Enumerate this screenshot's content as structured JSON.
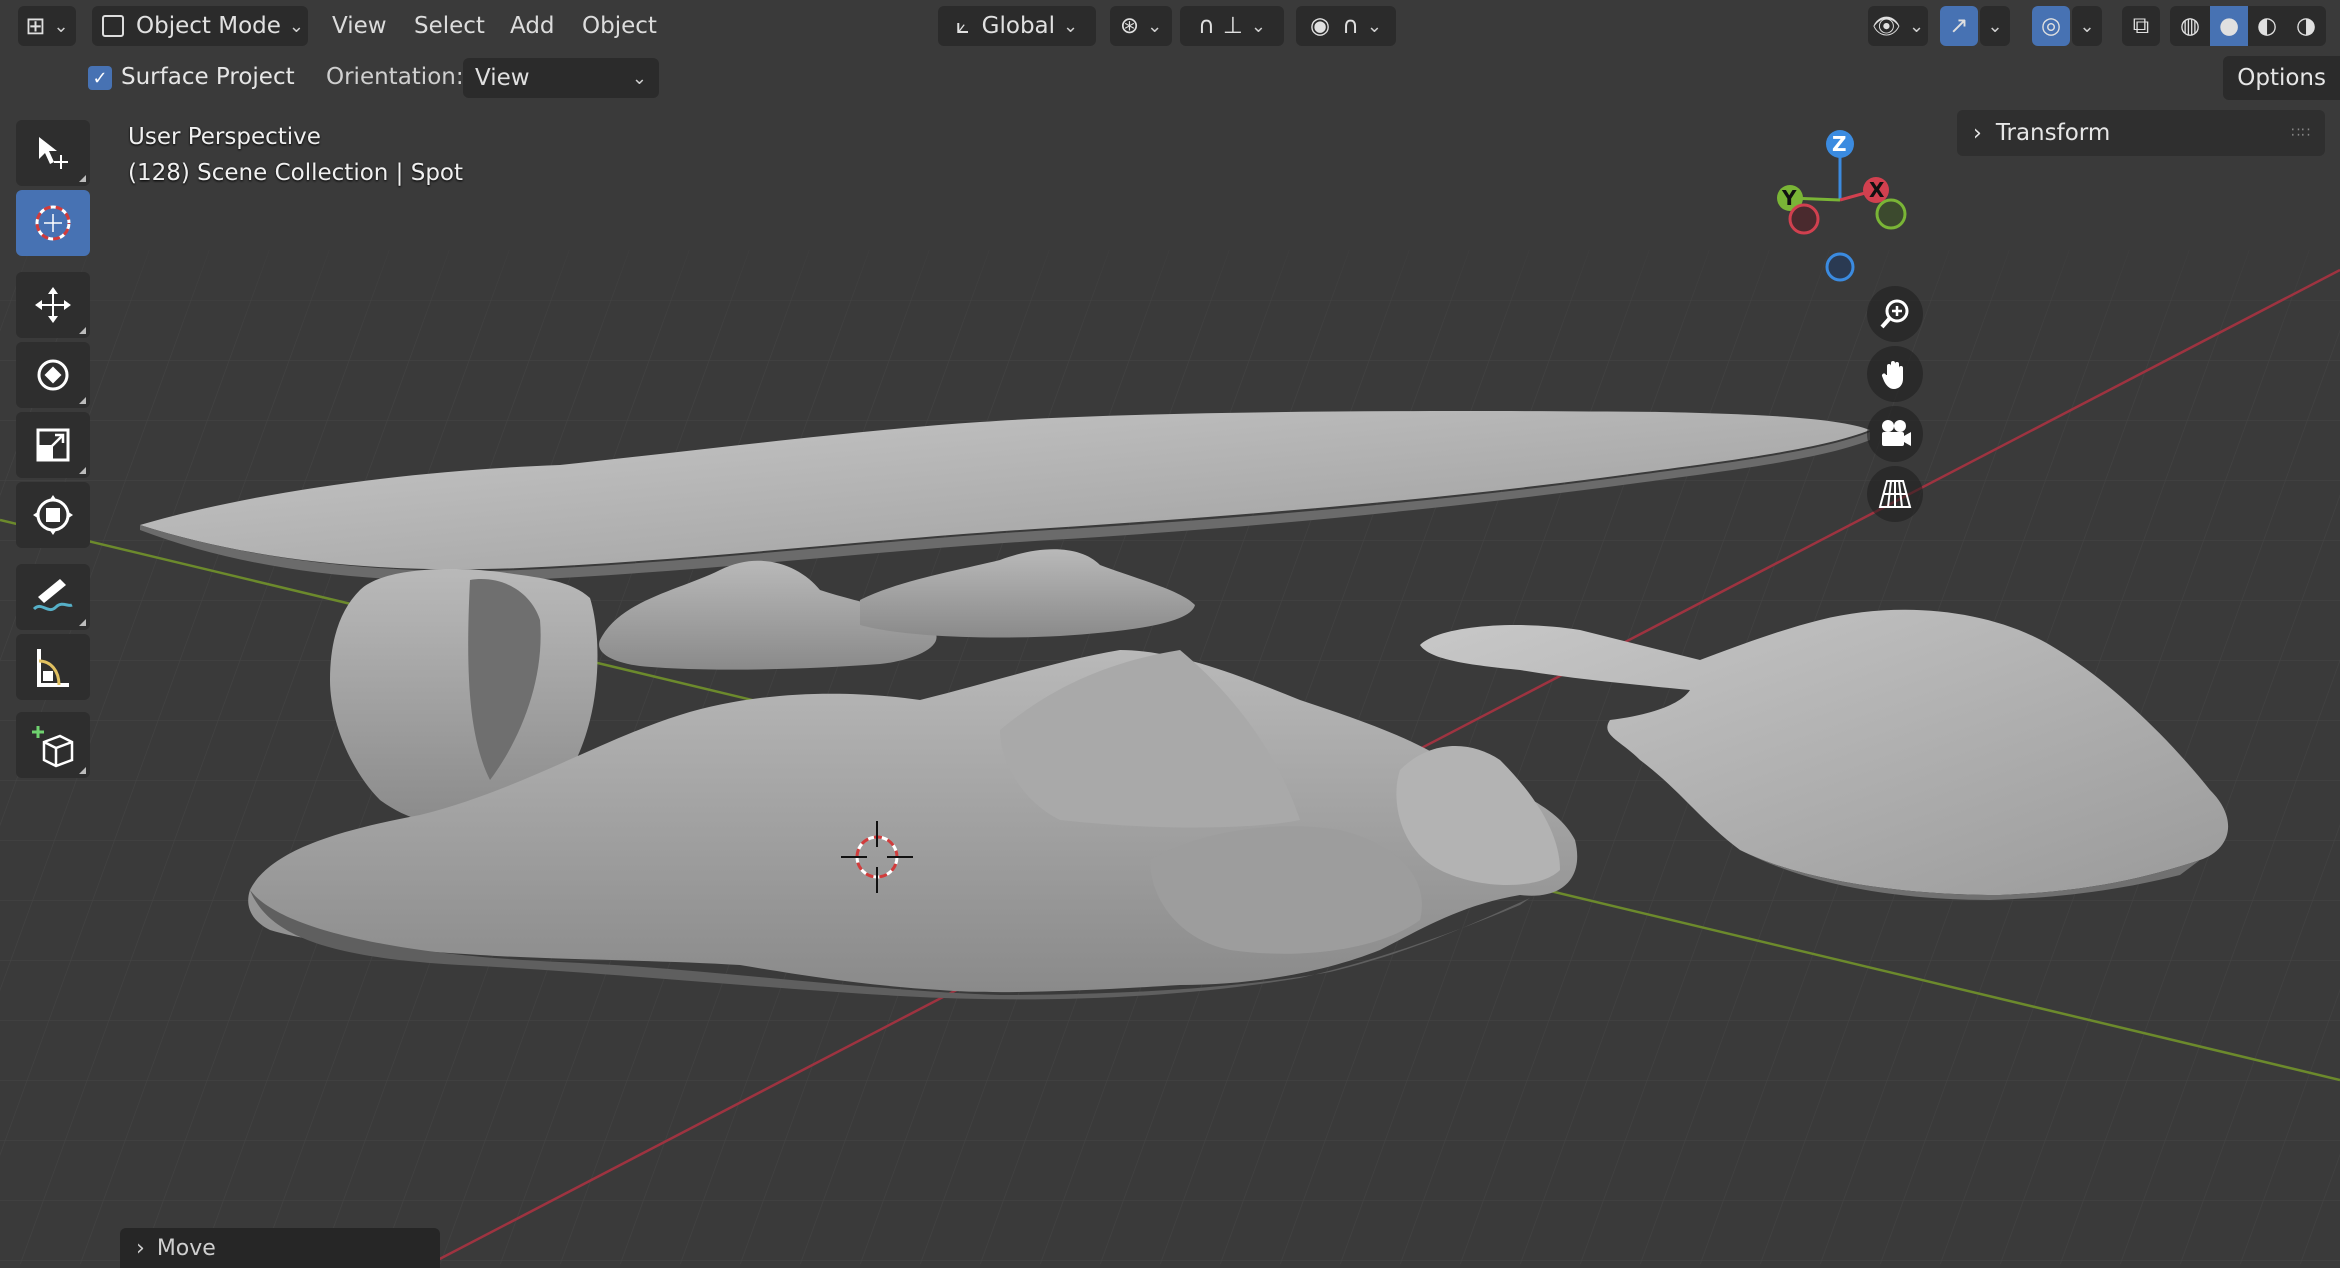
{
  "header": {
    "editor_type_icon": "grid-axes-icon",
    "mode_label": "Object Mode",
    "menus": [
      "View",
      "Select",
      "Add",
      "Object"
    ],
    "orientation_label": "Global",
    "options_label": "Options"
  },
  "tool_settings": {
    "surface_project_label": "Surface Project",
    "surface_project_checked": true,
    "orientation_label": "Orientation:",
    "orientation_value": "View"
  },
  "viewport": {
    "perspective_label": "User Perspective",
    "collection_label": "(128) Scene Collection | Spot"
  },
  "toolbar": {
    "tools": [
      "select-box-icon",
      "cursor-icon",
      "move-icon",
      "rotate-icon",
      "scale-icon",
      "transform-icon",
      "annotate-icon",
      "measure-icon",
      "add-cube-icon"
    ],
    "active_tool": "cursor-icon"
  },
  "gizmo": {
    "z_label": "Z",
    "y_label": "Y",
    "x_label": "X",
    "colors": {
      "x": "#d1404f",
      "y": "#7ab536",
      "z": "#3b8be0"
    }
  },
  "sidebar": {
    "transform_label": "Transform"
  },
  "last_operator": {
    "label": "Move"
  },
  "colors": {
    "accent": "#4772b3",
    "background": "#3a3a3a",
    "header": "#232323"
  }
}
